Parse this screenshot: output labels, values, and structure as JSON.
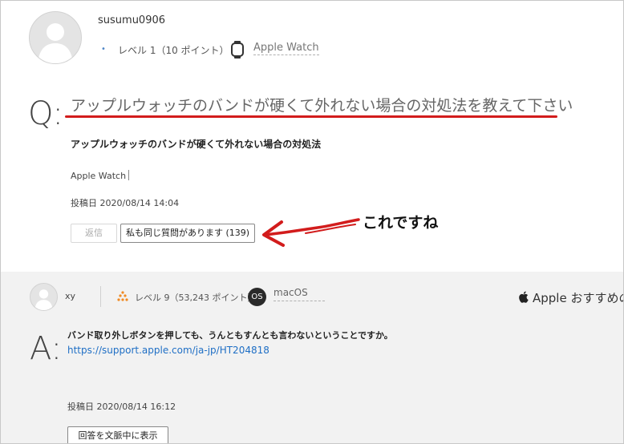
{
  "question": {
    "username": "susumu0906",
    "level_bullet": "•",
    "level": "レベル 1（10 ポイント）",
    "community_icon": "apple-watch-icon",
    "community": "Apple Watch",
    "mark": "Q:",
    "title": "アップルウォッチのバンドが硬くて外れない場合の対処法を教えて下さい",
    "body": "アップルウォッチのバンドが硬くて外れない場合の対処法",
    "tag": "Apple Watch",
    "posted": "投稿日 2020/08/14 14:04",
    "reply_button": "返信",
    "same_question_button": "私も同じ質問があります (139)"
  },
  "annotation": {
    "text": "これですね",
    "color": "#d21c1c"
  },
  "answer": {
    "username": "xy",
    "level_icon": "level-badge-icon",
    "level": "レベル 9（53,243 ポイント）",
    "os_badge": "OS",
    "community": "macOS",
    "recommend_icon": "apple-logo-icon",
    "recommend": "Apple おすすめの回答",
    "mark": "A:",
    "body": "バンド取り外しボタンを押しても、うんともすんとも言わないということですか。",
    "link": "https://support.apple.com/ja-jp/HT204818",
    "posted": "投稿日 2020/08/14 16:12",
    "context_button": "回答を文脈中に表示"
  },
  "colors": {
    "link": "#1f6fc5",
    "answer_bg": "#f2f2f2",
    "level_icon": "#f08a24"
  }
}
